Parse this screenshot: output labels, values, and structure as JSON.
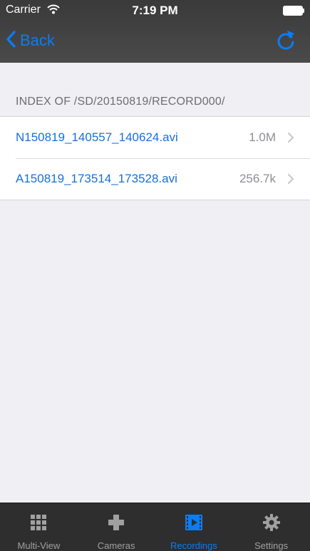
{
  "status_bar": {
    "carrier": "Carrier",
    "time": "7:19 PM"
  },
  "nav": {
    "back_label": "Back",
    "back_icon": "chevron-left-icon",
    "refresh_icon": "refresh-icon"
  },
  "section": {
    "header": "INDEX OF /SD/20150819/RECORD000/"
  },
  "files": [
    {
      "name": "N150819_140557_140624.avi",
      "size": "1.0M"
    },
    {
      "name": "A150819_173514_173528.avi",
      "size": "256.7k"
    }
  ],
  "tabs": [
    {
      "label": "Multi-View",
      "icon": "grid-icon"
    },
    {
      "label": "Cameras",
      "icon": "plus-icon"
    },
    {
      "label": "Recordings",
      "icon": "film-icon"
    },
    {
      "label": "Settings",
      "icon": "gear-icon"
    }
  ],
  "colors": {
    "accent": "#0a7df5",
    "link": "#1570d9",
    "bar": "#2e2e2e",
    "background": "#efeff4"
  }
}
